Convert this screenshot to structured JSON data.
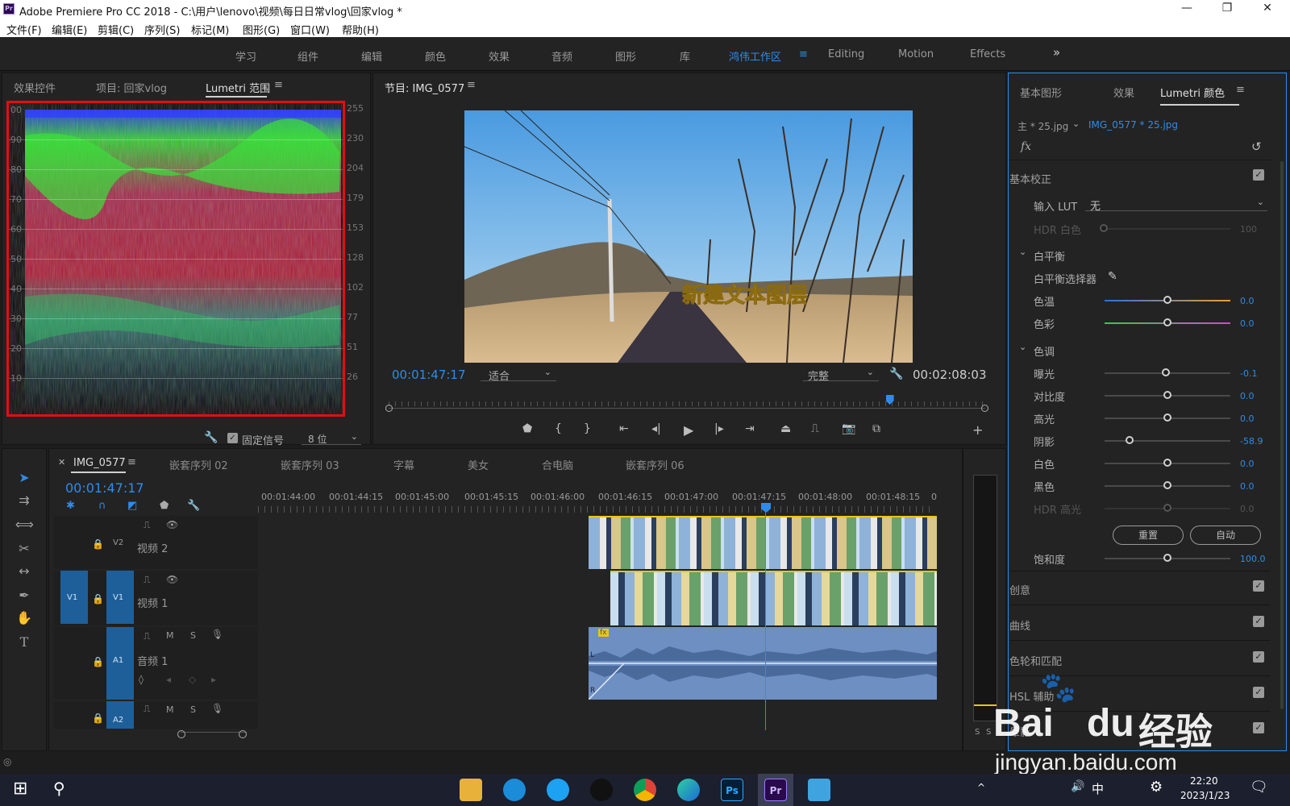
{
  "window": {
    "title": "Adobe Premiere Pro CC 2018 - C:\\用户\\lenovo\\视频\\每日日常vlog\\回家vlog *",
    "logo": "Pr"
  },
  "menu": [
    "文件(F)",
    "编辑(E)",
    "剪辑(C)",
    "序列(S)",
    "标记(M)",
    "图形(G)",
    "窗口(W)",
    "帮助(H)"
  ],
  "workspaces": [
    "学习",
    "组件",
    "编辑",
    "颜色",
    "效果",
    "音频",
    "图形",
    "库",
    "鸿伟工作区",
    "Editing",
    "Motion",
    "Effects"
  ],
  "active_workspace": "鸿伟工作区",
  "left_panel": {
    "tabs": [
      "效果控件",
      "项目: 回家vlog",
      "Lumetri 范围"
    ],
    "scale_left": [
      "00",
      "90",
      "80",
      "70",
      "60",
      "50",
      "40",
      "30",
      "20",
      "10"
    ],
    "scale_right": [
      "255",
      "230",
      "204",
      "179",
      "153",
      "128",
      "102",
      "77",
      "51",
      "26"
    ],
    "clamp_label": "固定信号",
    "bit_depth": "8 位"
  },
  "program": {
    "title": "节目: IMG_0577",
    "overlay_text": "新建文本图层",
    "current_time": "00:01:47:17",
    "fit": "适合",
    "quality": "完整",
    "duration": "00:02:08:03",
    "playhead_fraction": 0.84
  },
  "timeline": {
    "active_tab": "IMG_0577",
    "tabs": [
      "嵌套序列 02",
      "嵌套序列 03",
      "字幕",
      "美女",
      "合电脑",
      "嵌套序列 06"
    ],
    "timecode": "00:01:47:17",
    "ruler": [
      "00:01:44:00",
      "00:01:44:15",
      "00:01:45:00",
      "00:01:45:15",
      "00:01:46:00",
      "00:01:46:15",
      "00:01:47:00",
      "00:01:47:15",
      "00:01:48:00",
      "00:01:48:15",
      "0"
    ],
    "tracks": {
      "v2": "V2",
      "v2_name": "视频 2",
      "v1_src": "V1",
      "v1": "V1",
      "v1_name": "视频 1",
      "a1": "A1",
      "a1_name": "音频 1",
      "a2": "A2",
      "m": "M",
      "s": "S"
    },
    "clip_badge": "fx",
    "audio_l": "L",
    "audio_r": "R"
  },
  "meter": {
    "s1": "S",
    "s2": "S"
  },
  "lumetri": {
    "tabs": [
      "基本图形",
      "效果",
      "Lumetri 颜色"
    ],
    "master": "主 * 25.jpg",
    "clip": "IMG_0577 * 25.jpg",
    "fx": "fx",
    "basic": "基本校正",
    "input_lut_label": "输入 LUT",
    "input_lut": "无",
    "hdr_white_label": "HDR 白色",
    "hdr_white": "100",
    "white_balance": "白平衡",
    "wb_picker": "白平衡选择器",
    "tone": "色调",
    "rows": [
      {
        "label": "色温",
        "value": "0.0",
        "level": 0.5
      },
      {
        "label": "色彩",
        "value": "0.0",
        "level": 0.5
      },
      {
        "label": "曝光",
        "value": "-0.1",
        "level": 0.49
      },
      {
        "label": "对比度",
        "value": "0.0",
        "level": 0.5
      },
      {
        "label": "高光",
        "value": "0.0",
        "level": 0.5
      },
      {
        "label": "阴影",
        "value": "-58.9",
        "level": 0.2
      },
      {
        "label": "白色",
        "value": "0.0",
        "level": 0.5
      },
      {
        "label": "黑色",
        "value": "0.0",
        "level": 0.5
      },
      {
        "label": "HDR 高光",
        "value": "0.0",
        "level": 0.5
      }
    ],
    "reset": "重置",
    "auto": "自动",
    "saturation_label": "饱和度",
    "saturation": "100.0",
    "sections": [
      "创意",
      "曲线",
      "色轮和匹配",
      "HSL 辅助",
      "晕影"
    ]
  },
  "taskbar": {
    "time": "22:20",
    "date": "2023/1/23",
    "ime": "中",
    "ps": "Ps",
    "pr": "Pr"
  },
  "watermark": {
    "brand": "Bai",
    "brand2": "du",
    "site": "经验",
    "url": "jingyan.baidu.com"
  },
  "colors": {
    "accent": "#2d8ceb",
    "scope_border": "#e01010",
    "clip_yellow": "#e6c619",
    "audio": "#6e8fc2"
  }
}
